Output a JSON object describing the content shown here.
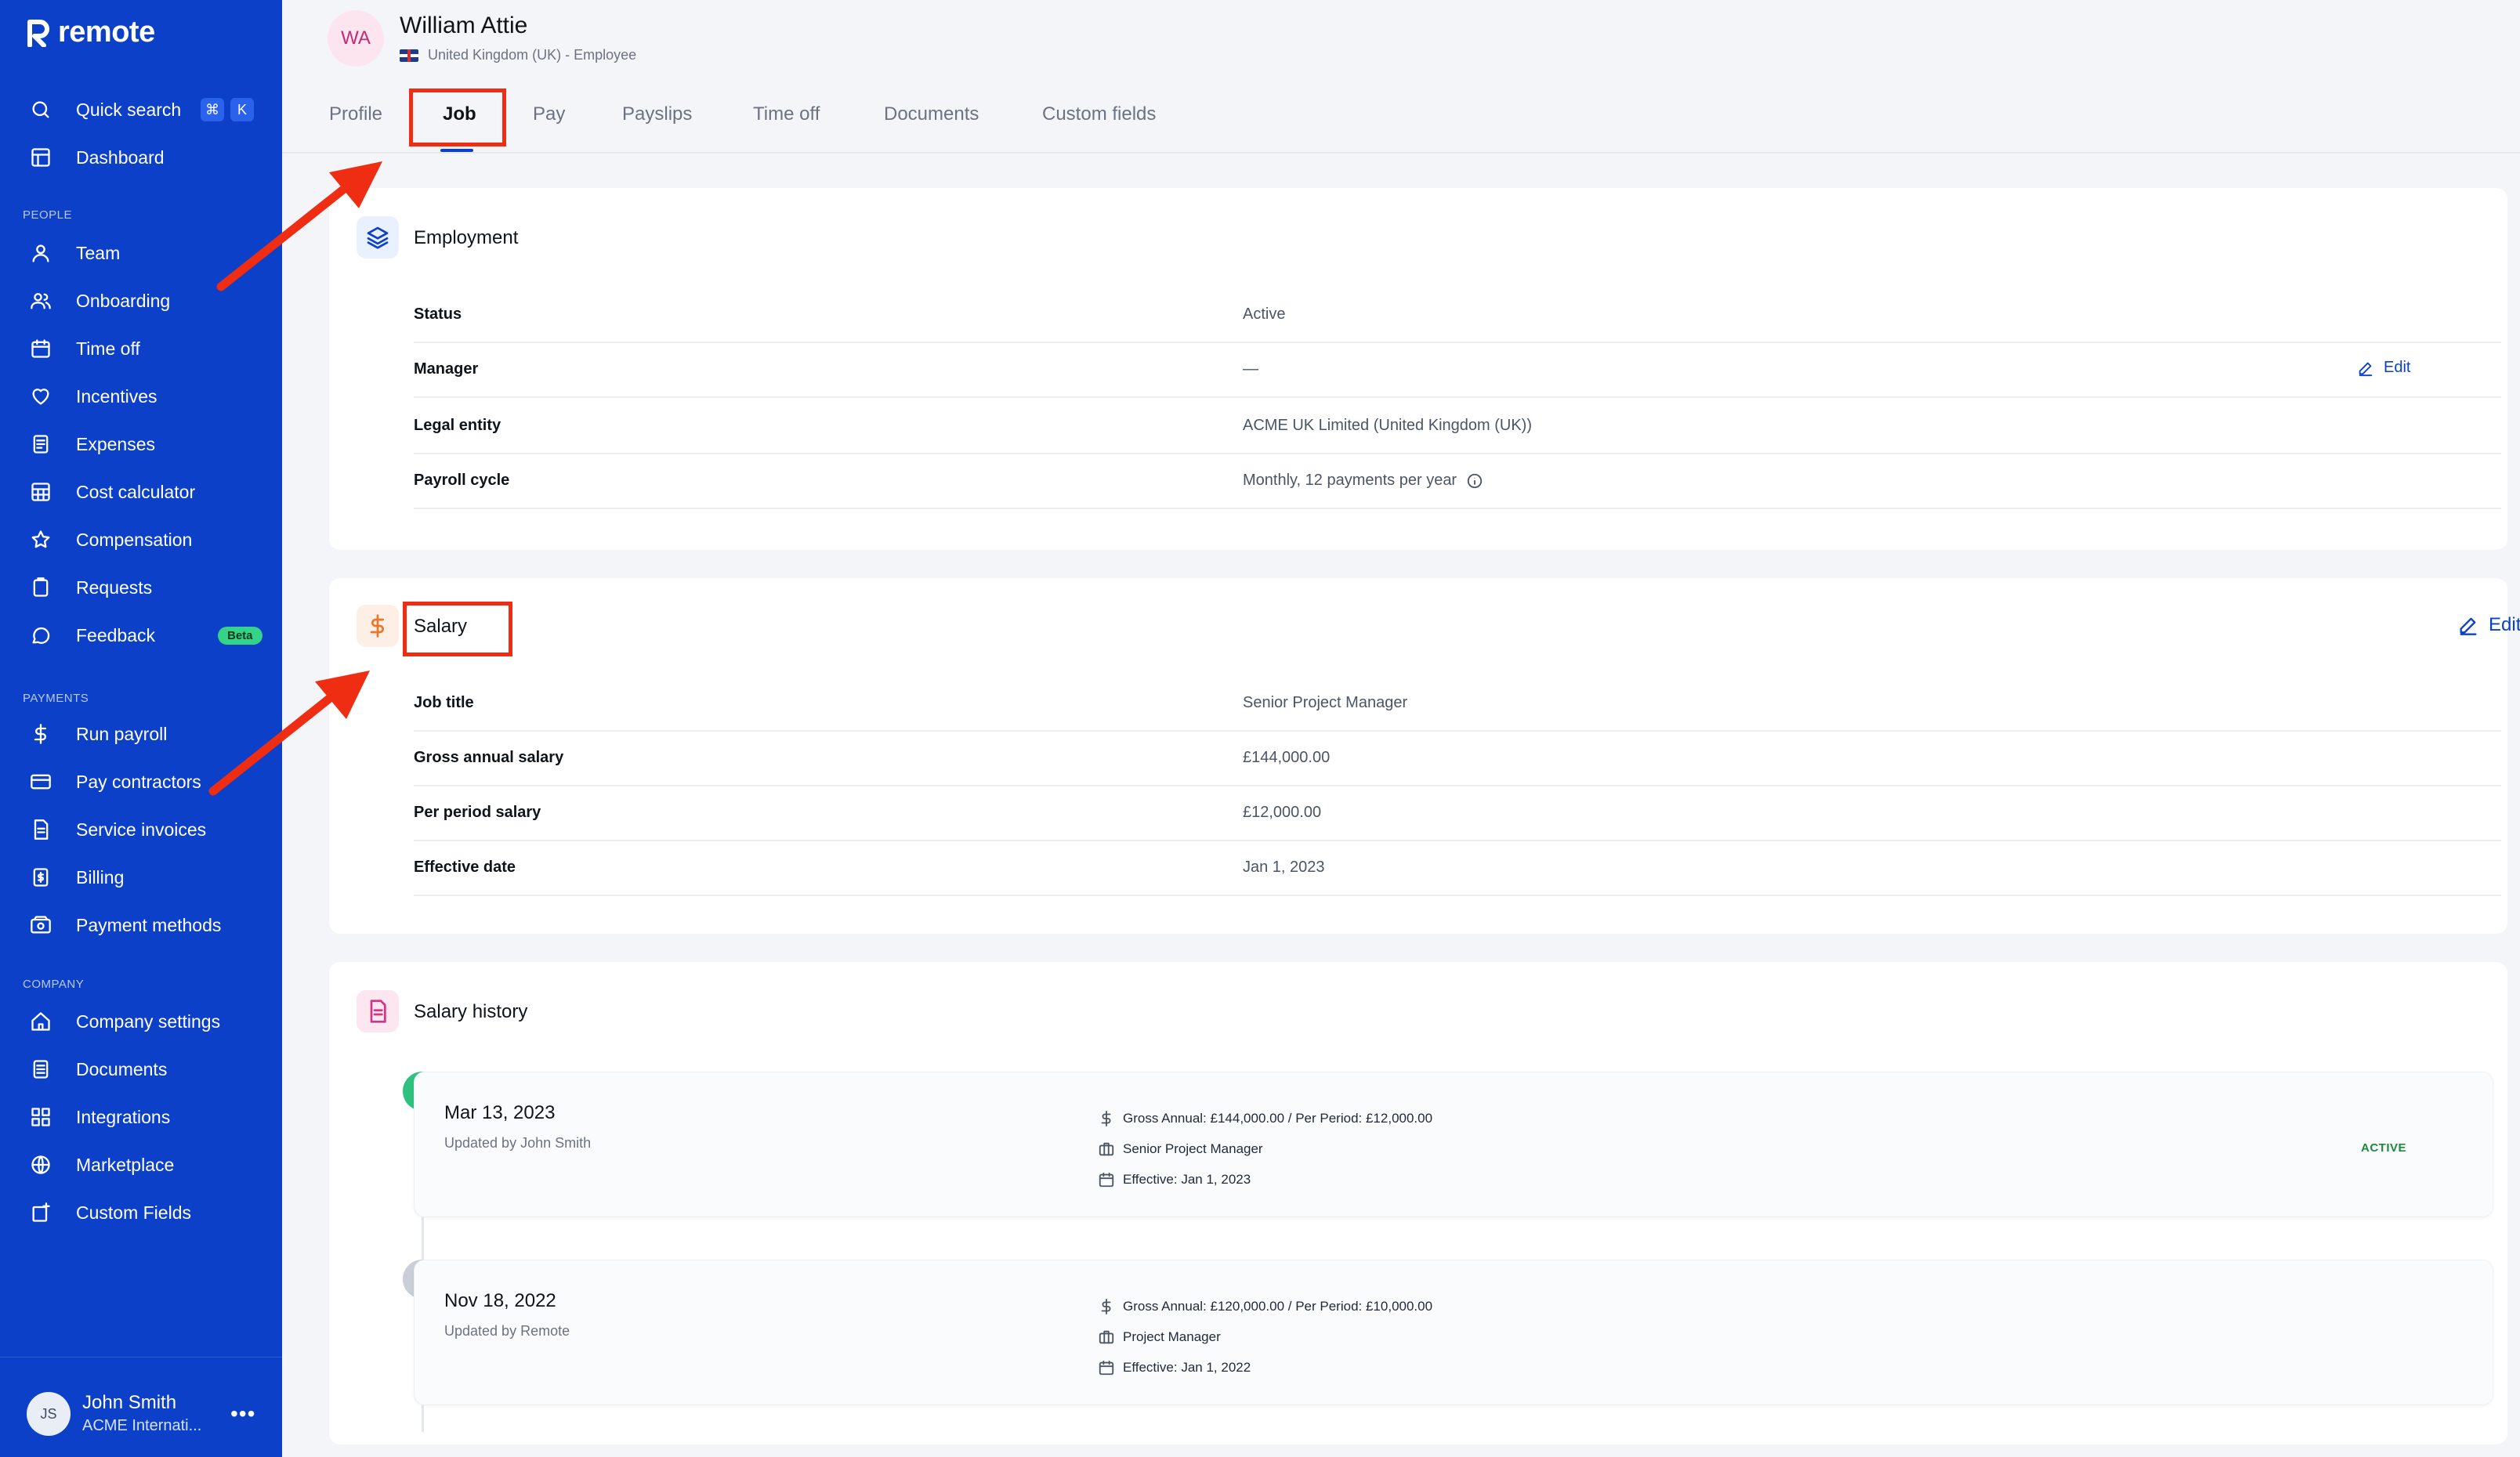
{
  "sidebar": {
    "brand": "remote",
    "quick_search": {
      "label": "Quick search",
      "keys": [
        "⌘",
        "K"
      ]
    },
    "dashboard": "Dashboard",
    "sections": {
      "people": "PEOPLE",
      "payments": "PAYMENTS",
      "company": "COMPANY"
    },
    "people_items": [
      {
        "label": "Team",
        "icon": "user-icon"
      },
      {
        "label": "Onboarding",
        "icon": "users-icon"
      },
      {
        "label": "Time off",
        "icon": "calendar-icon"
      },
      {
        "label": "Incentives",
        "icon": "heart-icon"
      },
      {
        "label": "Expenses",
        "icon": "receipt-icon"
      },
      {
        "label": "Cost calculator",
        "icon": "calculator-icon"
      },
      {
        "label": "Compensation",
        "icon": "star-icon"
      },
      {
        "label": "Requests",
        "icon": "clipboard-icon"
      },
      {
        "label": "Feedback",
        "icon": "chat-icon",
        "badge": "Beta"
      }
    ],
    "payment_items": [
      {
        "label": "Run payroll",
        "icon": "dollar-icon"
      },
      {
        "label": "Pay contractors",
        "icon": "card-icon"
      },
      {
        "label": "Service invoices",
        "icon": "invoice-icon"
      },
      {
        "label": "Billing",
        "icon": "billing-icon"
      },
      {
        "label": "Payment methods",
        "icon": "wallet-icon"
      }
    ],
    "company_items": [
      {
        "label": "Company settings",
        "icon": "home-icon"
      },
      {
        "label": "Documents",
        "icon": "document-icon"
      },
      {
        "label": "Integrations",
        "icon": "grid-icon"
      },
      {
        "label": "Marketplace",
        "icon": "globe-icon"
      },
      {
        "label": "Custom Fields",
        "icon": "custom-field-icon"
      }
    ],
    "user": {
      "initials": "JS",
      "name": "John Smith",
      "org": "ACME Internati..."
    }
  },
  "header": {
    "initials": "WA",
    "name": "William Attie",
    "subtitle": "United Kingdom (UK) - Employee"
  },
  "tabs": [
    "Profile",
    "Job",
    "Pay",
    "Payslips",
    "Time off",
    "Documents",
    "Custom fields"
  ],
  "active_tab": "Job",
  "employment": {
    "title": "Employment",
    "rows": [
      {
        "label": "Status",
        "value": "Active"
      },
      {
        "label": "Manager",
        "value": "—"
      },
      {
        "label": "Legal entity",
        "value": "ACME UK Limited (United Kingdom (UK))"
      },
      {
        "label": "Payroll cycle",
        "value": "Monthly, 12 payments per year"
      }
    ],
    "edit_label": "Edit"
  },
  "salary": {
    "title": "Salary",
    "edit_label": "Edit",
    "rows": [
      {
        "label": "Job title",
        "value": "Senior Project Manager"
      },
      {
        "label": "Gross annual salary",
        "value": "£144,000.00"
      },
      {
        "label": "Per period salary",
        "value": "£12,000.00"
      },
      {
        "label": "Effective date",
        "value": "Jan 1, 2023"
      }
    ]
  },
  "salary_history": {
    "title": "Salary history",
    "entries": [
      {
        "date": "Mar 13, 2023",
        "updated_by": "Updated by John Smith",
        "amount": "Gross Annual: £144,000.00 / Per Period: £12,000.00",
        "role": "Senior Project Manager",
        "effective": "Effective: Jan 1, 2023",
        "badge": "ACTIVE"
      },
      {
        "date": "Nov 18, 2022",
        "updated_by": "Updated by Remote",
        "amount": "Gross Annual: £120,000.00 / Per Period: £10,000.00",
        "role": "Project Manager",
        "effective": "Effective: Jan 1, 2022"
      }
    ]
  },
  "colors": {
    "sidebar": "#0c40c8",
    "accent": "#0c40c8",
    "annotation": "#ef2d12",
    "active_badge": "#1c8a3b"
  }
}
